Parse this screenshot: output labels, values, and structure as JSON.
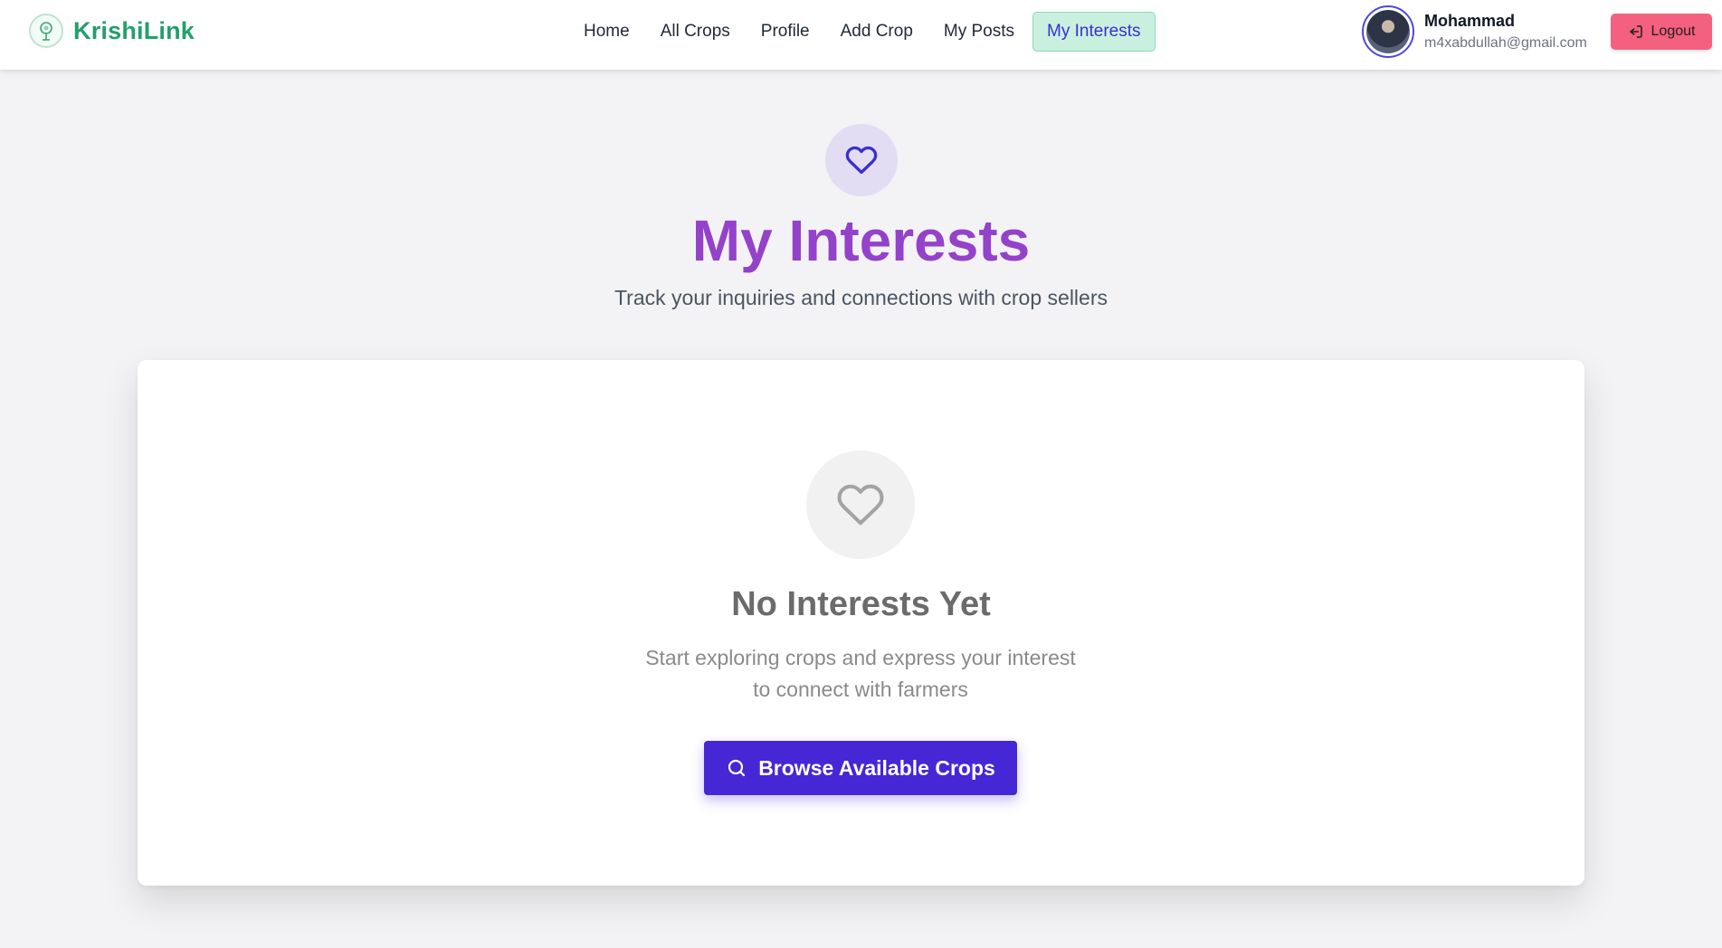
{
  "brand": {
    "name": "KrishiLink",
    "logo_icon": "tree-logo-icon",
    "color": "#22a06b"
  },
  "nav": {
    "items": [
      {
        "label": "Home",
        "active": false
      },
      {
        "label": "All Crops",
        "active": false
      },
      {
        "label": "Profile",
        "active": false
      },
      {
        "label": "Add Crop",
        "active": false
      },
      {
        "label": "My Posts",
        "active": false
      },
      {
        "label": "My Interests",
        "active": true
      }
    ]
  },
  "user": {
    "name": "Mohammad",
    "email": "m4xabdullah@gmail.com",
    "logout_label": "Logout",
    "logout_icon": "logout-icon"
  },
  "hero": {
    "icon": "heart-icon",
    "title": "My Interests",
    "subtitle": "Track your inquiries and connections with crop sellers"
  },
  "empty_state": {
    "icon": "heart-outline-icon",
    "title": "No Interests Yet",
    "description": "Start exploring crops and express your interest to connect with farmers",
    "button_label": "Browse Available Crops",
    "button_icon": "search-icon"
  },
  "colors": {
    "accent": "#4527d6",
    "title_purple": "#9442c9",
    "logout": "#f4607f",
    "active_nav_bg": "#c9f0de"
  }
}
